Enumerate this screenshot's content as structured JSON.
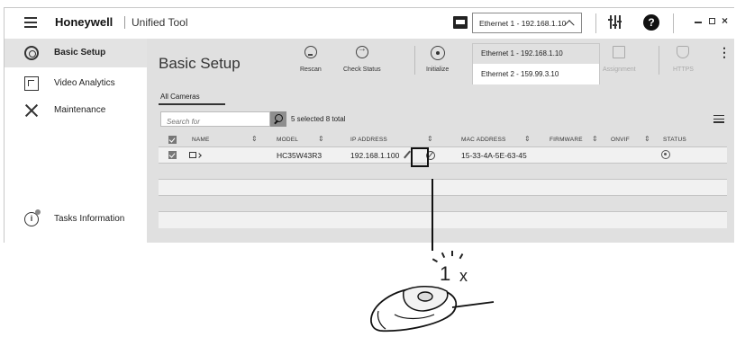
{
  "titlebar": {
    "brand": "Honeywell",
    "app_name": "Unified Tool",
    "network_selected": "Ethernet 1 - 192.168.1.10",
    "icons": [
      "menu-icon",
      "network-card-icon",
      "sliders-icon",
      "help-icon",
      "minimize-icon",
      "maximize-icon",
      "close-icon"
    ],
    "help_glyph": "?",
    "close_glyph": "×"
  },
  "network_dropdown": {
    "options": [
      "Ethernet 1 - 192.168.1.10",
      "Ethernet 2 - 159.99.3.10"
    ],
    "selected_index": 0
  },
  "sidebar": {
    "items": [
      {
        "label": "Basic Setup",
        "icon": "gear-icon",
        "active": true
      },
      {
        "label": "Video Analytics",
        "icon": "video-analytics-icon",
        "active": false
      },
      {
        "label": "Maintenance",
        "icon": "tools-icon",
        "active": false
      },
      {
        "label": "Tasks Information",
        "icon": "info-icon",
        "active": false
      }
    ],
    "info_glyph": "i"
  },
  "main": {
    "title": "Basic Setup",
    "toolbar": {
      "rescan": "Rescan",
      "check_status": "Check Status",
      "initialize": "Initialize",
      "assignment": "Assignment",
      "https": "HTTPS",
      "more": "⋮"
    },
    "tabs": [
      "All Cameras"
    ],
    "search": {
      "placeholder": "Search for"
    },
    "selection_summary": "5 selected  8 total",
    "columns": [
      "NAME",
      "MODEL",
      "IP ADDRESS",
      "MAC ADDRESS",
      "FIRMWARE",
      "ONVIF",
      "STATUS"
    ],
    "rows": [
      {
        "checked": true,
        "model": "HC35W43R3",
        "ip": "192.168.1.100",
        "mac": "15-33-4A-5E-63-45",
        "firmware": "",
        "onvif": ""
      }
    ]
  },
  "callout": {
    "count": "1",
    "multiplier": "x"
  },
  "colors": {
    "content_bg": "#e0e0e0",
    "active_sidebar": "#e3e3e3",
    "accent_dark": "#111111"
  }
}
